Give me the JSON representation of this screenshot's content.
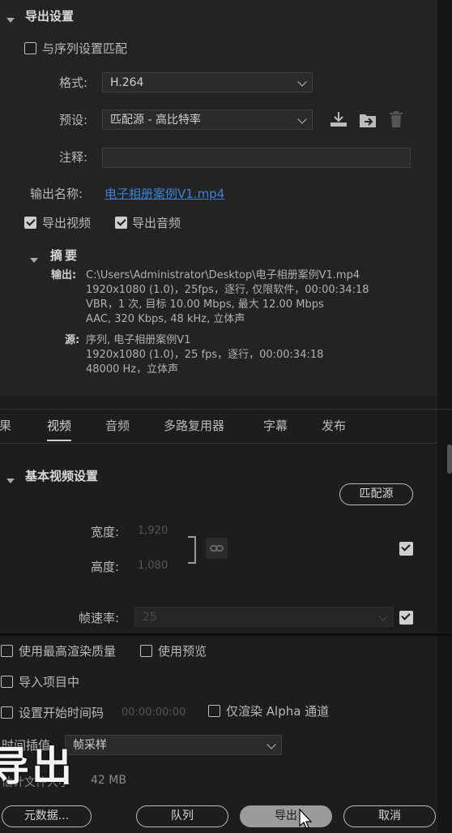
{
  "export_settings": {
    "title": "导出设置",
    "match_sequence": {
      "label": "与序列设置匹配",
      "checked": false
    },
    "format": {
      "label": "格式:",
      "value": "H.264"
    },
    "preset": {
      "label": "预设:",
      "value": "匹配源 - 高比特率"
    },
    "comments": {
      "label": "注释:",
      "value": ""
    },
    "output_name": {
      "label": "输出名称:",
      "value": "电子相册案例V1.mp4"
    },
    "export_video": {
      "label": "导出视频",
      "checked": true
    },
    "export_audio": {
      "label": "导出音频",
      "checked": true
    },
    "icons": [
      "save-preset-icon",
      "import-preset-icon",
      "delete-preset-icon"
    ]
  },
  "summary": {
    "title": "摘要",
    "output_label": "输出:",
    "output_lines": [
      "C:\\Users\\Administrator\\Desktop\\电子相册案例V1.mp4",
      "1920x1080 (1.0)，25fps，逐行, 仅限软件，00:00:34:18",
      "VBR，1 次, 目标 10.00 Mbps, 最大 12.00 Mbps",
      "AAC, 320 Kbps, 48  kHz, 立体声"
    ],
    "source_label": "源:",
    "source_lines": [
      "序列, 电子相册案例V1",
      "1920x1080 (1.0)，25 fps，逐行，00:00:34:18",
      "48000 Hz，立体声"
    ]
  },
  "tabs": [
    {
      "label": "效果",
      "active": false
    },
    {
      "label": "视频",
      "active": true
    },
    {
      "label": "音频",
      "active": false
    },
    {
      "label": "多路复用器",
      "active": false
    },
    {
      "label": "字幕",
      "active": false
    },
    {
      "label": "发布",
      "active": false
    }
  ],
  "video": {
    "section_title": "基本视频设置",
    "match_source_button": "匹配源",
    "width": {
      "label": "宽度:",
      "value": "1,920",
      "checked": true
    },
    "height": {
      "label": "高度:",
      "value": "1,080"
    },
    "frame_rate": {
      "label": "帧速率:",
      "value": "25",
      "checked": true
    }
  },
  "bottom": {
    "max_render_quality": {
      "label": "使用最高渲染质量",
      "checked": false
    },
    "use_previews": {
      "label": "使用预览",
      "checked": false
    },
    "import_into_project": {
      "label": "导入项目中",
      "checked": false
    },
    "set_start_timecode": {
      "label": "设置开始时间码",
      "value": "00:00:00:00",
      "checked": false
    },
    "render_alpha_only": {
      "label": "仅渲染 Alpha 通道",
      "checked": false
    },
    "time_interpolation": {
      "label": "时间插值",
      "value": "帧采样"
    },
    "estimated_file_size": {
      "label": "估计文件大小",
      "value": "42 MB"
    },
    "overlay_caption": "导出"
  },
  "buttons": {
    "metadata": "元数据...",
    "queue": "队列",
    "export": "导出",
    "cancel": "取消"
  }
}
